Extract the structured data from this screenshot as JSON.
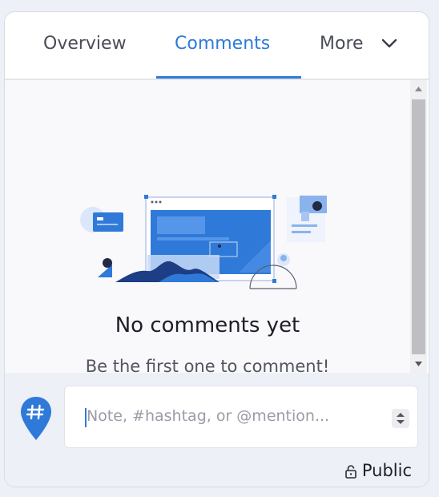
{
  "tabs": {
    "overview": "Overview",
    "comments": "Comments",
    "more": "More",
    "active": "comments"
  },
  "empty_state": {
    "title": "No comments yet",
    "subtitle": "Be the first one to comment!"
  },
  "composer": {
    "placeholder": "Note, #hashtag, or @mention...",
    "value": "",
    "visibility_label": "Public"
  },
  "colors": {
    "accent": "#2f7ad9",
    "pin": "#2f7ad9"
  },
  "icons": {
    "more": "chevron-down-icon",
    "composer": "hashtag-pin-icon",
    "visibility": "lock-icon"
  }
}
